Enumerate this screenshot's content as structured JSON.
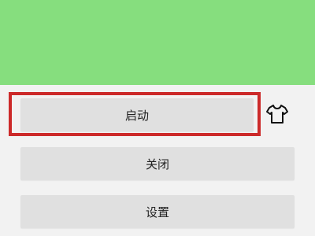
{
  "colors": {
    "banner": "#86de7e",
    "background": "#f2f2f2",
    "button": "#e0e0e0",
    "highlight_border": "#cc2a2a"
  },
  "buttons": {
    "start": "启动",
    "stop": "关闭",
    "settings": "设置"
  },
  "icons": {
    "shirt": "shirt-icon"
  }
}
